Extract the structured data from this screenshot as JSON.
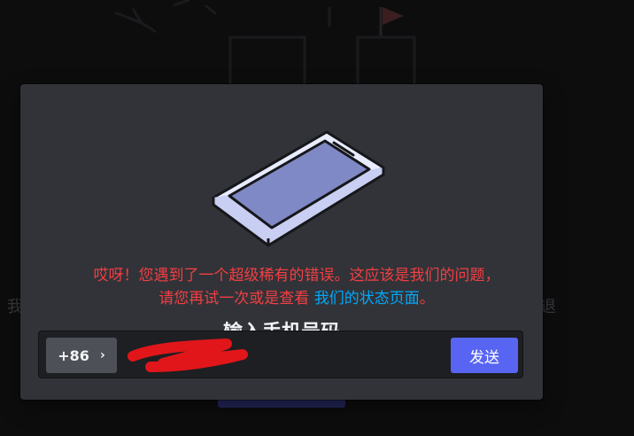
{
  "background": {
    "side_text_left": "我",
    "side_text_right": "退"
  },
  "modal": {
    "title": "输入手机号码",
    "error_line1": "哎呀！您遇到了一个超级稀有的错误。这应该是我们的问题，",
    "error_line2_prefix": "请您再试一次或是查看 ",
    "error_link": "我们的状态页面",
    "error_line2_suffix": "。",
    "phone": {
      "country_code": "+86",
      "chevron_icon": "chevron-right-icon",
      "value": "",
      "send_label": "发送"
    }
  },
  "colors": {
    "modal_bg": "#313338",
    "error": "#f23f43",
    "link": "#00a8fc",
    "button": "#5865f2",
    "redaction": "#e0161a"
  }
}
